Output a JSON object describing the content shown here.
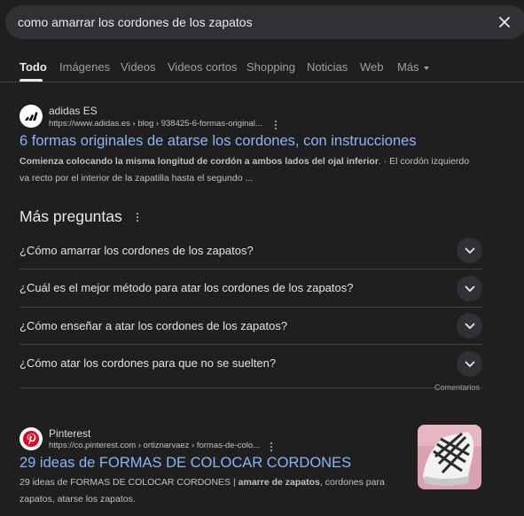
{
  "search": {
    "query": "como amarrar los cordones de los zapatos"
  },
  "tabs": [
    {
      "label": "Todo"
    },
    {
      "label": "Imágenes"
    },
    {
      "label": "Videos"
    },
    {
      "label": "Videos cortos"
    },
    {
      "label": "Shopping"
    },
    {
      "label": "Noticias"
    },
    {
      "label": "Web"
    },
    {
      "label": "Más"
    }
  ],
  "results": [
    {
      "site": "adidas ES",
      "url": "https://www.adidas.es › blog › 938425-6-formas-original...",
      "title": "6 formas originales de atarse los cordones, con instrucciones",
      "snippet_bold": "Comienza colocando la misma longitud de cordón a ambos lados del ojal inferior",
      "snippet_rest": ". · El cordón izquierdo va recto por el interior de la zapatilla hasta el segundo ..."
    },
    {
      "site": "Pinterest",
      "url": "https://co.pinterest.com › ortiznarvaez › formas-de-colo...",
      "title": "29 ideas de FORMAS DE COLOCAR CORDONES",
      "snippet_a": "29 ideas de FORMAS DE COLOCAR CORDONES | ",
      "snippet_bold": "amarre de zapatos",
      "snippet_b": ", cordones para zapatos, atarse los zapatos."
    }
  ],
  "paa": {
    "title": "Más preguntas",
    "questions": [
      "¿Cómo amarrar los cordones de los zapatos?",
      "¿Cuál es el mejor método para atar los cordones de los zapatos?",
      "¿Cómo enseñar a atar los cordones de los zapatos?",
      "¿Cómo atar los cordones para que no se suelten?"
    ],
    "feedback": "Comentarios"
  },
  "colors": {
    "background": "#1f1f1f",
    "link": "#8ab4f8",
    "text": "#e3e3e3",
    "pinterest": "#e60023"
  }
}
